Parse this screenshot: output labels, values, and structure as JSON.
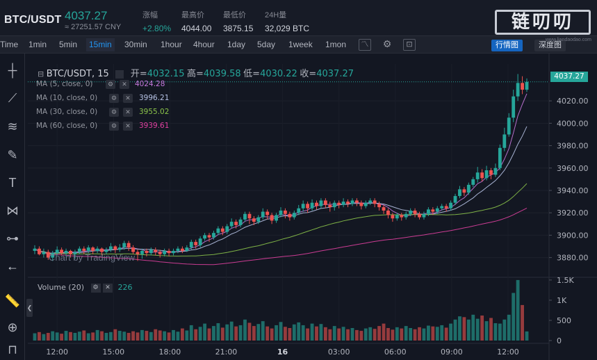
{
  "header": {
    "pair": "BTC/USDT",
    "last_price": "4037.27",
    "cny_price": "≈ 27251.57 CNY",
    "change_label": "涨幅",
    "change_value": "+2.80%",
    "high_label": "最高价",
    "high_value": "4044.00",
    "low_label": "最低价",
    "low_value": "3875.15",
    "vol_label": "24H量",
    "vol_value": "32,029 BTC",
    "logo_text": "链叨叨",
    "logo_url": "www.liandaodao.com"
  },
  "toolbar": {
    "timeframes": [
      "Time",
      "1min",
      "5min",
      "15min",
      "30min",
      "1hour",
      "4hour",
      "1day",
      "5day",
      "1week",
      "1mon"
    ],
    "active_timeframe": "15min",
    "icons": [
      "chart-type-icon",
      "settings-icon",
      "screenshot-icon"
    ],
    "view_kline": "行情图",
    "view_depth": "深度图"
  },
  "left_tools": [
    "crosshair-icon",
    "trendline-icon",
    "fib-icon",
    "brush-icon",
    "text-icon",
    "pattern-icon",
    "measure-icon",
    "back-arrow-icon",
    "ruler-icon",
    "zoom-in-icon",
    "magnet-icon"
  ],
  "legend": {
    "symbol": "BTC/USDT, 15",
    "open_label": "开=",
    "open": "4032.15",
    "high_label": "高=",
    "high": "4039.58",
    "low_label": "低=",
    "low": "4030.22",
    "close_label": "收=",
    "close": "4037.27"
  },
  "ma": [
    {
      "label": "MA (5, close, 0)",
      "value": "4024.28",
      "color": "#c678dd"
    },
    {
      "label": "MA (10, close, 0)",
      "value": "3996.21",
      "color": "#b7c3e5"
    },
    {
      "label": "MA (30, close, 0)",
      "value": "3955.02",
      "color": "#8bc34a"
    },
    {
      "label": "MA (60, close, 0)",
      "value": "3939.61",
      "color": "#e040a0"
    }
  ],
  "volume_legend": {
    "label": "Volume (20)",
    "value": "226"
  },
  "watermark": "Chart by TradingView",
  "current_price_tag": "4037.27",
  "colors": {
    "up": "#26a69a",
    "down": "#ef5350"
  },
  "chart_data": {
    "type": "candlestick",
    "price_ticks": [
      "4020.00",
      "4000.00",
      "3980.00",
      "3960.00",
      "3940.00",
      "3920.00",
      "3900.00",
      "3880.00"
    ],
    "price_range": [
      3863,
      4053
    ],
    "volume_ticks": [
      "1.5K",
      "1K",
      "500",
      "0"
    ],
    "volume_range": [
      0,
      1550
    ],
    "time_ticks": [
      "12:00",
      "15:00",
      "18:00",
      "21:00",
      "16",
      "03:00",
      "06:00",
      "09:00",
      "12:00"
    ],
    "candles": [
      [
        3886,
        3888,
        3883,
        3891
      ],
      [
        3888,
        3883,
        3882,
        3890
      ],
      [
        3883,
        3885,
        3880,
        3888
      ],
      [
        3885,
        3880,
        3878,
        3887
      ],
      [
        3880,
        3884,
        3877,
        3886
      ],
      [
        3884,
        3887,
        3882,
        3890
      ],
      [
        3887,
        3884,
        3882,
        3889
      ],
      [
        3884,
        3886,
        3881,
        3888
      ],
      [
        3886,
        3883,
        3880,
        3887
      ],
      [
        3883,
        3885,
        3879,
        3887
      ],
      [
        3885,
        3888,
        3883,
        3890
      ],
      [
        3888,
        3886,
        3883,
        3890
      ],
      [
        3886,
        3889,
        3884,
        3891
      ],
      [
        3889,
        3886,
        3883,
        3890
      ],
      [
        3886,
        3888,
        3884,
        3890
      ],
      [
        3888,
        3885,
        3882,
        3889
      ],
      [
        3885,
        3887,
        3883,
        3889
      ],
      [
        3887,
        3890,
        3885,
        3893
      ],
      [
        3890,
        3887,
        3884,
        3891
      ],
      [
        3887,
        3889,
        3885,
        3892
      ],
      [
        3889,
        3893,
        3887,
        3895
      ],
      [
        3893,
        3889,
        3886,
        3895
      ],
      [
        3889,
        3885,
        3883,
        3891
      ],
      [
        3885,
        3883,
        3877,
        3887
      ],
      [
        3883,
        3886,
        3879,
        3888
      ],
      [
        3886,
        3884,
        3881,
        3888
      ],
      [
        3884,
        3887,
        3882,
        3889
      ],
      [
        3887,
        3885,
        3882,
        3889
      ],
      [
        3885,
        3883,
        3880,
        3887
      ],
      [
        3883,
        3886,
        3881,
        3888
      ],
      [
        3886,
        3884,
        3881,
        3888
      ],
      [
        3884,
        3886,
        3882,
        3888
      ],
      [
        3886,
        3888,
        3884,
        3890
      ],
      [
        3888,
        3886,
        3884,
        3890
      ],
      [
        3886,
        3889,
        3885,
        3891
      ],
      [
        3889,
        3894,
        3887,
        3896
      ],
      [
        3894,
        3891,
        3888,
        3896
      ],
      [
        3891,
        3897,
        3889,
        3899
      ],
      [
        3897,
        3900,
        3895,
        3902
      ],
      [
        3900,
        3898,
        3894,
        3902
      ],
      [
        3898,
        3902,
        3896,
        3904
      ],
      [
        3902,
        3906,
        3900,
        3908
      ],
      [
        3906,
        3903,
        3900,
        3908
      ],
      [
        3903,
        3908,
        3901,
        3910
      ],
      [
        3908,
        3912,
        3906,
        3915
      ],
      [
        3912,
        3909,
        3906,
        3914
      ],
      [
        3909,
        3914,
        3907,
        3916
      ],
      [
        3914,
        3919,
        3912,
        3921
      ],
      [
        3919,
        3915,
        3910,
        3921
      ],
      [
        3915,
        3912,
        3909,
        3917
      ],
      [
        3912,
        3916,
        3910,
        3918
      ],
      [
        3916,
        3921,
        3914,
        3924
      ],
      [
        3921,
        3918,
        3914,
        3923
      ],
      [
        3918,
        3913,
        3910,
        3920
      ],
      [
        3913,
        3918,
        3911,
        3920
      ],
      [
        3918,
        3922,
        3916,
        3925
      ],
      [
        3922,
        3919,
        3915,
        3924
      ],
      [
        3919,
        3916,
        3913,
        3921
      ],
      [
        3916,
        3920,
        3914,
        3922
      ],
      [
        3920,
        3924,
        3918,
        3927
      ],
      [
        3924,
        3928,
        3921,
        3931
      ],
      [
        3928,
        3924,
        3920,
        3930
      ],
      [
        3924,
        3929,
        3922,
        3932
      ],
      [
        3929,
        3926,
        3923,
        3931
      ],
      [
        3926,
        3931,
        3924,
        3933
      ],
      [
        3931,
        3927,
        3924,
        3933
      ],
      [
        3927,
        3925,
        3921,
        3930
      ],
      [
        3925,
        3929,
        3922,
        3931
      ],
      [
        3929,
        3927,
        3924,
        3931
      ],
      [
        3927,
        3930,
        3925,
        3933
      ],
      [
        3930,
        3928,
        3925,
        3932
      ],
      [
        3928,
        3931,
        3926,
        3933
      ],
      [
        3931,
        3929,
        3926,
        3933
      ],
      [
        3929,
        3926,
        3923,
        3931
      ],
      [
        3926,
        3929,
        3924,
        3931
      ],
      [
        3929,
        3931,
        3927,
        3933
      ],
      [
        3931,
        3928,
        3925,
        3933
      ],
      [
        3928,
        3925,
        3922,
        3930
      ],
      [
        3925,
        3922,
        3919,
        3927
      ],
      [
        3922,
        3918,
        3915,
        3924
      ],
      [
        3918,
        3915,
        3912,
        3920
      ],
      [
        3915,
        3918,
        3913,
        3920
      ],
      [
        3918,
        3916,
        3913,
        3920
      ],
      [
        3916,
        3919,
        3914,
        3921
      ],
      [
        3919,
        3922,
        3917,
        3924
      ],
      [
        3922,
        3919,
        3916,
        3924
      ],
      [
        3919,
        3916,
        3914,
        3921
      ],
      [
        3916,
        3919,
        3914,
        3921
      ],
      [
        3919,
        3923,
        3917,
        3925
      ],
      [
        3923,
        3921,
        3918,
        3925
      ],
      [
        3921,
        3924,
        3919,
        3926
      ],
      [
        3924,
        3926,
        3922,
        3928
      ],
      [
        3926,
        3924,
        3921,
        3928
      ],
      [
        3924,
        3929,
        3922,
        3931
      ],
      [
        3929,
        3935,
        3927,
        3937
      ],
      [
        3935,
        3941,
        3933,
        3944
      ],
      [
        3941,
        3938,
        3935,
        3943
      ],
      [
        3938,
        3945,
        3936,
        3947
      ],
      [
        3945,
        3950,
        3943,
        3952
      ],
      [
        3950,
        3956,
        3947,
        3961
      ],
      [
        3956,
        3951,
        3948,
        3959
      ],
      [
        3951,
        3958,
        3949,
        3962
      ],
      [
        3958,
        3954,
        3950,
        3960
      ],
      [
        3954,
        3960,
        3952,
        3964
      ],
      [
        3960,
        3978,
        3958,
        3981
      ],
      [
        3978,
        3990,
        3975,
        3996
      ],
      [
        3990,
        4005,
        3988,
        4009
      ],
      [
        4005,
        4024,
        4001,
        4030
      ],
      [
        4024,
        4036,
        4020,
        4044
      ],
      [
        4036,
        4030,
        4026,
        4042
      ],
      [
        4030,
        4037,
        4028,
        4040
      ]
    ],
    "volumes": [
      180,
      210,
      160,
      190,
      230,
      200,
      170,
      240,
      210,
      190,
      220,
      250,
      180,
      200,
      260,
      230,
      190,
      210,
      280,
      240,
      220,
      190,
      230,
      200,
      260,
      240,
      210,
      280,
      250,
      230,
      200,
      260,
      220,
      300,
      250,
      380,
      280,
      340,
      420,
      300,
      360,
      430,
      320,
      400,
      470,
      350,
      380,
      520,
      440,
      360,
      410,
      480,
      350,
      300,
      380,
      460,
      340,
      310,
      400,
      450,
      380,
      300,
      420,
      350,
      410,
      330,
      280,
      360,
      300,
      340,
      280,
      310,
      260,
      240,
      300,
      330,
      290,
      360,
      420,
      310,
      270,
      330,
      300,
      360,
      310,
      280,
      330,
      300,
      370,
      350,
      340,
      380,
      320,
      420,
      520,
      600,
      580,
      520,
      640,
      540,
      620,
      480,
      560,
      430,
      420,
      520,
      640,
      1180,
      1500,
      880,
      226
    ],
    "ma_series": [
      "MA5",
      "MA10",
      "MA30",
      "MA60"
    ]
  }
}
